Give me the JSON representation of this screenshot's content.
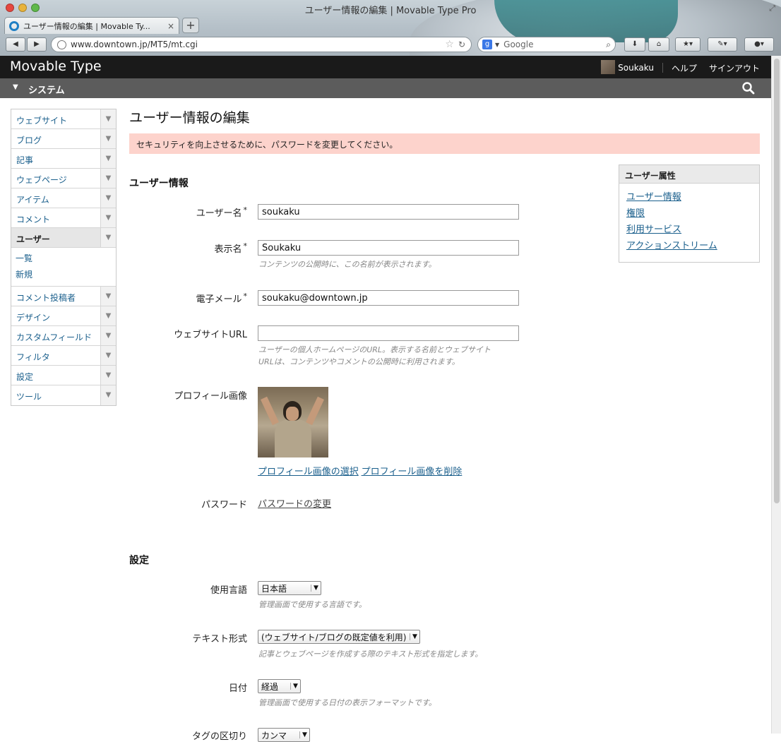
{
  "browser": {
    "window_title": "ユーザー情報の編集 | Movable Type Pro",
    "tab_label": "ユーザー情報の編集 | Movable Ty...",
    "tab_close": "×",
    "new_tab": "+",
    "url": "www.downtown.jp/MT5/mt.cgi",
    "search_engine": "g",
    "search_placeholder": "Google"
  },
  "header": {
    "logo": "Movable Type",
    "username": "Soukaku",
    "help": "ヘルプ",
    "signout": "サインアウト"
  },
  "system_bar": {
    "label": "システム"
  },
  "sidebar": {
    "items": [
      {
        "label": "ウェブサイト"
      },
      {
        "label": "ブログ"
      },
      {
        "label": "記事"
      },
      {
        "label": "ウェブページ"
      },
      {
        "label": "アイテム"
      },
      {
        "label": "コメント"
      },
      {
        "label": "ユーザー"
      },
      {
        "label": "コメント投稿者"
      },
      {
        "label": "デザイン"
      },
      {
        "label": "カスタムフィールド"
      },
      {
        "label": "フィルタ"
      },
      {
        "label": "設定"
      },
      {
        "label": "ツール"
      }
    ],
    "submenu": [
      "一覧",
      "新規"
    ]
  },
  "main": {
    "title": "ユーザー情報の編集",
    "alert": "セキュリティを向上させるために、パスワードを変更してください。",
    "section_user": "ユーザー情報",
    "section_settings": "設定",
    "required_mark": "*",
    "fields": {
      "username": {
        "label": "ユーザー名",
        "value": "soukaku"
      },
      "display_name": {
        "label": "表示名",
        "value": "Soukaku",
        "hint": "コンテンツの公開時に、この名前が表示されます。"
      },
      "email": {
        "label": "電子メール",
        "value": "soukaku@downtown.jp"
      },
      "website": {
        "label": "ウェブサイトURL",
        "value": "",
        "hint_line1": "ユーザーの個人ホームページのURL。表示する名前とウェブサイト",
        "hint_line2": "URLは、コンテンツやコメントの公開時に利用されます。"
      },
      "profile_image": {
        "label": "プロフィール画像",
        "select_link": "プロフィール画像の選択",
        "delete_link": "プロフィール画像を削除"
      },
      "password": {
        "label": "パスワード",
        "link": "パスワードの変更"
      },
      "language": {
        "label": "使用言語",
        "value": "日本語",
        "hint": "管理画面で使用する言語です。"
      },
      "text_format": {
        "label": "テキスト形式",
        "value": "(ウェブサイト/ブログの既定値を利用)",
        "hint": "記事とウェブページを作成する際のテキスト形式を指定します。"
      },
      "date": {
        "label": "日付",
        "value": "経過",
        "hint": "管理画面で使用する日付の表示フォーマットです。"
      },
      "tag_delimiter": {
        "label": "タグの区切り",
        "value": "カンマ"
      }
    }
  },
  "side_panel": {
    "title": "ユーザー属性",
    "links": [
      "ユーザー情報",
      "権限",
      "利用サービス",
      "アクションストリーム"
    ]
  }
}
